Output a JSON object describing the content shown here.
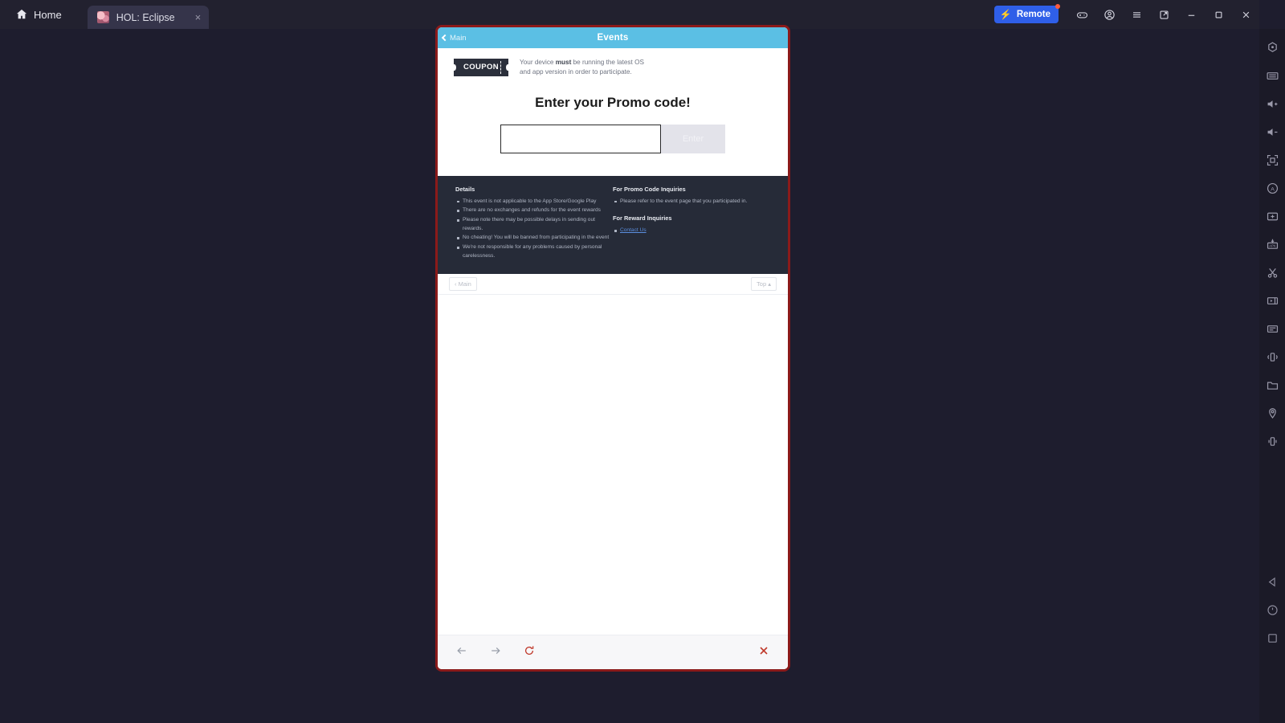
{
  "titlebar": {
    "home_label": "Home",
    "home_icon": "home-icon",
    "tab": {
      "label": "HOL: Eclipse",
      "close_label": "×",
      "app_icon": "app-thumbnail-icon"
    },
    "remote": {
      "label": "Remote",
      "bolt_icon": "lightning-bolt-icon",
      "badge": "●",
      "color": "#2f5fe8"
    },
    "icons": [
      {
        "name": "gamepad-icon"
      },
      {
        "name": "account-icon"
      },
      {
        "name": "menu-icon"
      },
      {
        "name": "new-window-icon"
      },
      {
        "name": "minimize-icon"
      },
      {
        "name": "maximize-icon"
      },
      {
        "name": "close-icon"
      }
    ]
  },
  "sidebar": {
    "items": [
      {
        "name": "multi-instance-icon",
        "label": "Multi Instance"
      },
      {
        "name": "keyboard-icon",
        "label": "Keyboard Controls"
      },
      {
        "name": "volume-up-icon",
        "label": "Volume Up"
      },
      {
        "name": "volume-down-icon",
        "label": "Volume Down"
      },
      {
        "name": "fullscreen-icon",
        "label": "Fullscreen"
      },
      {
        "name": "auto-rotate-icon",
        "label": "Rotate"
      },
      {
        "name": "screenshot-gallery-icon",
        "label": "Media Manager"
      },
      {
        "name": "install-apk-icon",
        "label": "Install APK"
      },
      {
        "name": "scissors-icon",
        "label": "Screenshot"
      },
      {
        "name": "video-record-icon",
        "label": "Screen Recorder"
      },
      {
        "name": "macro-recorder-icon",
        "label": "Macro Recorder"
      },
      {
        "name": "shake-icon",
        "label": "Shake"
      },
      {
        "name": "folder-icon",
        "label": "Shared Folder"
      },
      {
        "name": "location-icon",
        "label": "Location"
      },
      {
        "name": "vibrate-icon",
        "label": "Vibrate"
      }
    ],
    "nav": [
      {
        "name": "android-back-icon",
        "label": "Back"
      },
      {
        "name": "android-home-icon",
        "label": "Home"
      },
      {
        "name": "android-recents-icon",
        "label": "Recents"
      }
    ]
  },
  "event_page": {
    "header": {
      "back_label": "Main",
      "title": "Events",
      "accent": "#5bbfe4"
    },
    "notice": {
      "badge": "COUPON",
      "line1_pre": "Your device ",
      "line1_bold": "must",
      "line1_post": " be running the latest OS",
      "line2": "and app version in order to participate."
    },
    "promo": {
      "title": "Enter your Promo code!",
      "input_value": "",
      "input_placeholder": "",
      "submit_label": "Enter"
    },
    "details": {
      "left_heading": "Details",
      "left_items": [
        "This event is not applicable to the App Store/Google Play",
        "There are no exchanges and refunds for the event rewards",
        "Please note there may be possible delays in sending out rewards.",
        "No cheating! You will be banned from participating in the event",
        "We're not responsible for any problems caused by personal carelessness."
      ],
      "right_heading_1": "For Promo Code Inquiries",
      "right_items_1": [
        "Please refer to the event page that you participated in."
      ],
      "right_heading_2": "For Reward Inquiries",
      "right_link_label": "Contact Us"
    },
    "footer": {
      "main_label": "‹ Main",
      "top_label": "Top ▴"
    }
  },
  "browser_bar": {
    "back": "back-arrow-icon",
    "forward": "forward-arrow-icon",
    "reload": "reload-icon",
    "close": "close-icon",
    "reload_color": "#c0392b"
  }
}
